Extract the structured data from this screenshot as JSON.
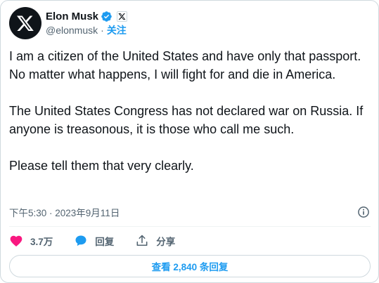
{
  "author": {
    "display_name": "Elon Musk",
    "handle": "@elonmusk",
    "separator": "·",
    "follow_label": "关注"
  },
  "tweet": {
    "paragraphs": [
      "I am a citizen of the United States and have only that passport. No matter what happens, I will fight for and die in America.",
      "The United States Congress has not declared war on Russia. If anyone is treasonous, it is those who call me such.",
      "Please tell them that very clearly."
    ],
    "timestamp": "下午5:30 · 2023年9月11日"
  },
  "actions": {
    "like_count": "3.7万",
    "reply_label": "回复",
    "share_label": "分享"
  },
  "replies_button": "查看 2,840 条回复",
  "colors": {
    "accent": "#1d9bf0",
    "like": "#f91880",
    "text": "#0f1419",
    "muted": "#536471",
    "border": "#cfd9de"
  },
  "icons": [
    "x-logo-icon",
    "verified-badge-icon",
    "x-affiliate-icon",
    "info-icon",
    "heart-icon",
    "reply-icon",
    "share-icon"
  ]
}
